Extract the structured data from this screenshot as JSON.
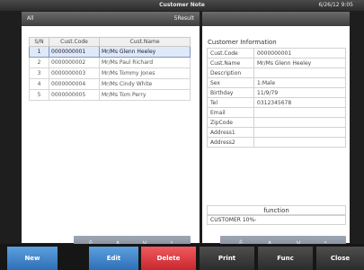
{
  "window": {
    "title": "Customer Note",
    "time": "6/26/12 9:05"
  },
  "list": {
    "filter": "All",
    "count": "5Result",
    "columns": [
      "S/N",
      "Cust.Code",
      "Cust.Name"
    ],
    "rows": [
      {
        "sn": "1",
        "code": "0000000001",
        "name": "Mr/Ms Glenn Heeley"
      },
      {
        "sn": "2",
        "code": "0000000002",
        "name": "Mr/Ms Paul Richard"
      },
      {
        "sn": "3",
        "code": "0000000003",
        "name": "Mr/Ms Tommy Jones"
      },
      {
        "sn": "4",
        "code": "0000000004",
        "name": "Mr/Ms Cindy White"
      },
      {
        "sn": "5",
        "code": "0000000005",
        "name": "Mr/Ms Tom Perry"
      }
    ]
  },
  "nav": {
    "first": "⩯",
    "prev": "∧",
    "next": "∨",
    "last": "⩡"
  },
  "info": {
    "title": "Customer Information",
    "fields": [
      {
        "label": "Cust.Code",
        "value": "0000000001"
      },
      {
        "label": "Cust.Name",
        "value": "Mr/Ms Glenn Heeley"
      },
      {
        "label": "Description",
        "value": ""
      },
      {
        "label": "Sex",
        "value": "1:Male"
      },
      {
        "label": "Birthday",
        "value": "11/9/79"
      },
      {
        "label": "Tel",
        "value": "0312345678"
      },
      {
        "label": "Email",
        "value": ""
      },
      {
        "label": "ZipCode",
        "value": ""
      },
      {
        "label": "Address1",
        "value": ""
      },
      {
        "label": "Address2",
        "value": ""
      }
    ],
    "function_header": "function",
    "function_value": "CUSTOMER 10%-"
  },
  "buttons": {
    "new": "New",
    "edit": "Edit",
    "delete": "Delete",
    "print": "Print",
    "func": "Func",
    "close": "Close"
  },
  "colors": {
    "blue": "#3f83c9",
    "red": "#e0353b",
    "dark": "#3a3a3a",
    "selected": "#dfe9f7"
  }
}
